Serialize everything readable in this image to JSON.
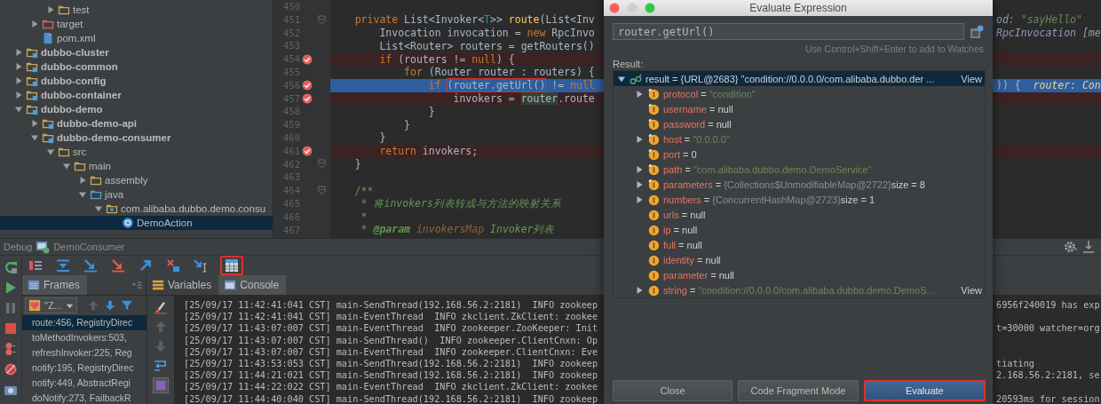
{
  "project_tree": {
    "cut_branch": {
      "inner": [
        {
          "label": "test",
          "kind": "folder",
          "expanded": false,
          "selected": false
        }
      ],
      "outer": [
        {
          "label": "target",
          "kind": "excluded",
          "expanded": false,
          "selected": false
        },
        {
          "label": "pom.xml",
          "kind": "file",
          "selected": false
        }
      ]
    },
    "items": [
      {
        "label": "dubbo-cluster",
        "kind": "module",
        "expanded": false,
        "selected": false
      },
      {
        "label": "dubbo-common",
        "kind": "module",
        "expanded": false,
        "selected": false
      },
      {
        "label": "dubbo-config",
        "kind": "module",
        "expanded": false,
        "selected": false
      },
      {
        "label": "dubbo-container",
        "kind": "module",
        "expanded": false,
        "selected": false
      },
      {
        "label": "dubbo-demo",
        "kind": "module",
        "expanded": true,
        "selected": false,
        "children": [
          {
            "label": "dubbo-demo-api",
            "kind": "module",
            "expanded": false,
            "selected": false
          },
          {
            "label": "dubbo-demo-consumer",
            "kind": "module",
            "expanded": true,
            "selected": false,
            "children": [
              {
                "label": "src",
                "kind": "folder",
                "expanded": true,
                "selected": false,
                "children": [
                  {
                    "label": "main",
                    "kind": "folder",
                    "expanded": true,
                    "selected": false,
                    "children": [
                      {
                        "label": "assembly",
                        "kind": "folder",
                        "expanded": false,
                        "selected": false
                      },
                      {
                        "label": "java",
                        "kind": "source",
                        "expanded": true,
                        "selected": false,
                        "children": [
                          {
                            "label": "com.alibaba.dubbo.demo.consu",
                            "kind": "package",
                            "expanded": true,
                            "selected": false,
                            "children": [
                              {
                                "label": "DemoAction",
                                "kind": "class",
                                "selected": true
                              }
                            ]
                          }
                        ]
                      }
                    ]
                  }
                ]
              }
            ]
          }
        ]
      }
    ]
  },
  "editor": {
    "lines": [
      {
        "number": "450",
        "breakpoint": false,
        "current": false,
        "foldable": false
      },
      {
        "number": "451",
        "breakpoint": false,
        "current": false,
        "foldable": true,
        "tokens": [
          {
            "text": "    private ",
            "kind": "kw"
          },
          {
            "text": "List<Invoker<",
            "kind": "plain"
          },
          {
            "text": "T",
            "kind": "typeparam"
          },
          {
            "text": ">> ",
            "kind": "plain"
          },
          {
            "text": "route",
            "kind": "fn"
          },
          {
            "text": "(List<Inv",
            "kind": "plain"
          }
        ],
        "right": [
          {
            "text": "od: ",
            "kind": "debug"
          },
          {
            "text": "\"sayHello\"",
            "kind": "debugstr"
          }
        ]
      },
      {
        "number": "452",
        "breakpoint": false,
        "current": false,
        "foldable": false,
        "tokens": [
          {
            "text": "        Invocation invocation = ",
            "kind": "plain"
          },
          {
            "text": "new ",
            "kind": "kw"
          },
          {
            "text": "RpcInvo",
            "kind": "plain"
          }
        ],
        "right": [
          {
            "text": "RpcInvocation [me",
            "kind": "debug"
          }
        ]
      },
      {
        "number": "453",
        "breakpoint": false,
        "current": false,
        "foldable": false,
        "tokens": [
          {
            "text": "        List<Router> routers = getRouters()",
            "kind": "plain"
          }
        ]
      },
      {
        "number": "454",
        "breakpoint": true,
        "current": false,
        "foldable": false,
        "tokens": [
          {
            "text": "        if ",
            "kind": "kw"
          },
          {
            "text": "(routers != ",
            "kind": "plain"
          },
          {
            "text": "null",
            "kind": "kw"
          },
          {
            "text": ") {",
            "kind": "plain"
          }
        ]
      },
      {
        "number": "455",
        "breakpoint": false,
        "current": false,
        "foldable": false,
        "tokens": [
          {
            "text": "            for ",
            "kind": "kw"
          },
          {
            "text": "(Router router : routers) {",
            "kind": "plain"
          }
        ]
      },
      {
        "number": "456",
        "breakpoint": true,
        "current": true,
        "foldable": false,
        "tokens": [
          {
            "text": "                if ",
            "kind": "kw"
          },
          {
            "text": "(router.getUrl()",
            "kind": "plain",
            "highlighted": true
          },
          {
            "text": " != ",
            "kind": "plain"
          },
          {
            "text": "null",
            "kind": "kw"
          }
        ],
        "right": [
          {
            "text": ")) {  ",
            "kind": "plain"
          },
          {
            "text": "router: Con",
            "kind": "debug"
          }
        ]
      },
      {
        "number": "457",
        "breakpoint": true,
        "current": false,
        "foldable": false,
        "tokens": [
          {
            "text": "                    invokers = ",
            "kind": "plain"
          },
          {
            "text": "router",
            "kind": "usage"
          },
          {
            "text": ".route",
            "kind": "plain"
          }
        ]
      },
      {
        "number": "458",
        "breakpoint": false,
        "current": false,
        "foldable": false,
        "tokens": [
          {
            "text": "                }",
            "kind": "plain"
          }
        ]
      },
      {
        "number": "459",
        "breakpoint": false,
        "current": false,
        "foldable": false,
        "tokens": [
          {
            "text": "            }",
            "kind": "plain"
          }
        ]
      },
      {
        "number": "460",
        "breakpoint": false,
        "current": false,
        "foldable": false,
        "tokens": [
          {
            "text": "        }",
            "kind": "plain"
          }
        ]
      },
      {
        "number": "461",
        "breakpoint": true,
        "current": false,
        "foldable": false,
        "tokens": [
          {
            "text": "        return ",
            "kind": "kw"
          },
          {
            "text": "invokers;",
            "kind": "plain"
          }
        ]
      },
      {
        "number": "462",
        "breakpoint": false,
        "current": false,
        "foldable": true,
        "tokens": [
          {
            "text": "    }",
            "kind": "plain"
          }
        ]
      },
      {
        "number": "463",
        "breakpoint": false,
        "current": false,
        "foldable": false
      },
      {
        "number": "464",
        "breakpoint": false,
        "current": false,
        "foldable": true,
        "tokens": [
          {
            "text": "    /**",
            "kind": "doc"
          }
        ]
      },
      {
        "number": "465",
        "breakpoint": false,
        "current": false,
        "foldable": false,
        "tokens": [
          {
            "text": "     * 将invokers列表转成与方法的映射关系",
            "kind": "doc"
          }
        ]
      },
      {
        "number": "466",
        "breakpoint": false,
        "current": false,
        "foldable": false,
        "tokens": [
          {
            "text": "     *",
            "kind": "doc"
          }
        ]
      },
      {
        "number": "467",
        "breakpoint": false,
        "current": false,
        "foldable": false,
        "tokens": [
          {
            "text": "     * ",
            "kind": "doc"
          },
          {
            "text": "@param ",
            "kind": "doctag"
          },
          {
            "text": "invokersMap ",
            "kind": "docparam"
          },
          {
            "text": "Invoker列表",
            "kind": "doc"
          }
        ]
      }
    ]
  },
  "debug_panel": {
    "title": "Debug",
    "config": "DemoConsumer",
    "toolbar": [
      {
        "kind": "show-execution-point",
        "highlighted": false
      },
      {
        "kind": "step-over",
        "highlighted": false
      },
      {
        "kind": "step-into",
        "highlighted": false
      },
      {
        "kind": "force-step-into",
        "highlighted": false
      },
      {
        "kind": "step-out",
        "highlighted": false
      },
      {
        "kind": "drop-frame",
        "highlighted": false
      },
      {
        "kind": "run-to-cursor",
        "highlighted": false
      },
      {
        "kind": "evaluate",
        "highlighted": true
      }
    ],
    "frames_tab": {
      "label": "Frames",
      "selected": true
    },
    "tabs": [
      {
        "label": "Variables",
        "kind": "variables",
        "selected": false
      },
      {
        "label": "Console",
        "kind": "console",
        "selected": true
      }
    ],
    "thread": "\"Z...",
    "frames": [
      {
        "label": "route:456, RegistryDirec",
        "selected": true
      },
      {
        "label": "toMethodInvokers:503,",
        "selected": false
      },
      {
        "label": "refreshInvoker:225, Reg",
        "selected": false
      },
      {
        "label": "notify:195, RegistryDirec",
        "selected": false
      },
      {
        "label": "notify:449, AbstractRegi",
        "selected": false
      },
      {
        "label": "doNotify:273, FailbackR",
        "selected": false
      }
    ],
    "console": [
      {
        "text": "[25/09/17 11:42:41:041 CST] main-SendThread(192.168.56.2:2181)  INFO zookeep",
        "right": "6956f240019 has exp"
      },
      {
        "text": "[25/09/17 11:42:41:041 CST] main-EventThread  INFO zkclient.ZkClient: zookee"
      },
      {
        "text": "[25/09/17 11:43:07:007 CST] main-EventThread  INFO zookeeper.ZooKeeper: Init",
        "right": "t=30000 watcher=org"
      },
      {
        "text": "[25/09/17 11:43:07:007 CST] main-SendThread()  INFO zookeeper.ClientCnxn: Op"
      },
      {
        "text": "[25/09/17 11:43:07:007 CST] main-EventThread  INFO zookeeper.ClientCnxn: Eve"
      },
      {
        "text": "[25/09/17 11:43:53:053 CST] main-SendThread(192.168.56.2:2181)  INFO zookeep",
        "right": "tiating"
      },
      {
        "text": "[25/09/17 11:44:21:021 CST] main-SendThread(192.168.56.2:2181)  INFO zookeep",
        "right": "2.168.56.2:2181, se"
      },
      {
        "text": "[25/09/17 11:44:22:022 CST] main-EventThread  INFO zkclient.ZkClient: zookee"
      },
      {
        "text": "[25/09/17 11:44:40:040 CST] main-SendThread(192.168.56.2:2181)  INFO zookeep",
        "right": "20593ms for session"
      }
    ]
  },
  "dialog": {
    "title": "Evaluate Expression",
    "expression": "router.getUrl()",
    "hint": "Use Control+Shift+Enter to add to Watches",
    "result_label": "Result:",
    "result": [
      {
        "name": "result",
        "eq": "=",
        "value": "{URL@2683} \"condition://0.0.0.0/com.alibaba.dubbo.der ...",
        "link": "View",
        "kind": "watch",
        "expanded": true,
        "selected": true,
        "children": [
          {
            "name": "protocol",
            "eq": "=",
            "value": "\"condition\"",
            "kind": "string",
            "final": true,
            "expanded": false,
            "selected": false
          },
          {
            "name": "username",
            "eq": "=",
            "value": "null",
            "kind": "plain",
            "final": true,
            "selected": false
          },
          {
            "name": "password",
            "eq": "=",
            "value": "null",
            "kind": "plain",
            "final": true,
            "selected": false
          },
          {
            "name": "host",
            "eq": "=",
            "value": "\"0.0.0.0\"",
            "kind": "string",
            "final": true,
            "expanded": false,
            "selected": false
          },
          {
            "name": "port",
            "eq": "=",
            "value": "0",
            "kind": "plain",
            "final": true,
            "selected": false
          },
          {
            "name": "path",
            "eq": "=",
            "value": "\"com.alibaba.dubbo.demo.DemoService\"",
            "kind": "string",
            "final": true,
            "expanded": false,
            "selected": false
          },
          {
            "name": "parameters",
            "eq": "=",
            "value": "{Collections$UnmodifiableMap@2722}",
            "kind": "ref",
            "extra": "size = 8",
            "final": true,
            "expanded": false,
            "selected": false
          },
          {
            "name": "numbers",
            "eq": "=",
            "value": "{ConcurrentHashMap@2723}",
            "kind": "ref",
            "extra": "size = 1",
            "final": false,
            "expanded": false,
            "selected": false
          },
          {
            "name": "urls",
            "eq": "=",
            "value": "null",
            "kind": "plain",
            "final": false,
            "selected": false
          },
          {
            "name": "ip",
            "eq": "=",
            "value": "null",
            "kind": "plain",
            "final": false,
            "selected": false
          },
          {
            "name": "full",
            "eq": "=",
            "value": "null",
            "kind": "plain",
            "final": false,
            "selected": false
          },
          {
            "name": "identity",
            "eq": "=",
            "value": "null",
            "kind": "plain",
            "final": false,
            "selected": false
          },
          {
            "name": "parameter",
            "eq": "=",
            "value": "null",
            "kind": "plain",
            "final": false,
            "selected": false
          },
          {
            "name": "string",
            "eq": "=",
            "value": "\"condition://0.0.0.0/com.alibaba.dubbo.demo.DemoS...",
            "kind": "string",
            "link": "View",
            "final": false,
            "expanded": false,
            "selected": false
          }
        ]
      }
    ],
    "buttons": [
      {
        "label": "Close",
        "default": false,
        "highlighted": false
      },
      {
        "label": "Code Fragment Mode",
        "default": false,
        "highlighted": false
      },
      {
        "label": "Evaluate",
        "default": true,
        "highlighted": true
      }
    ]
  }
}
